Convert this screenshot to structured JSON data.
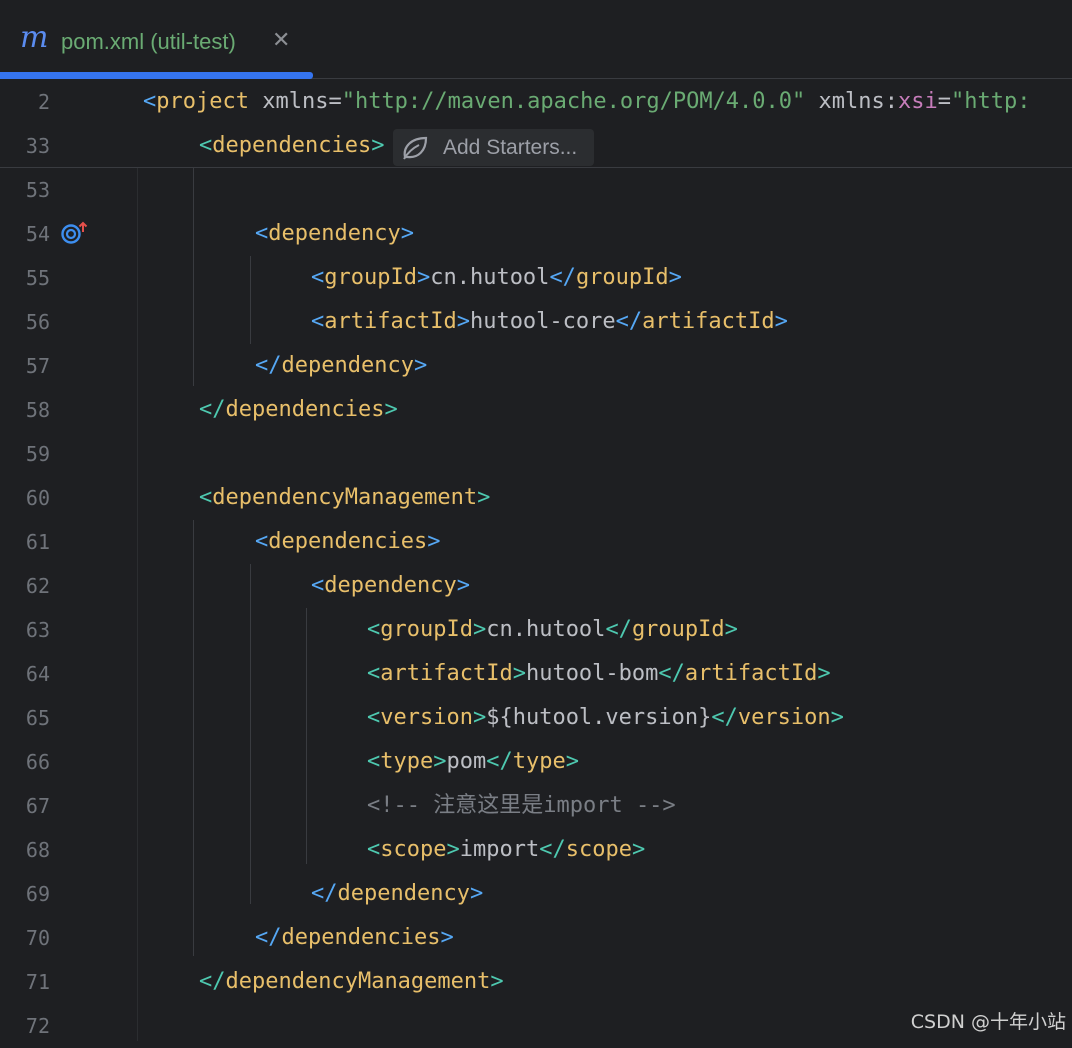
{
  "tab": {
    "icon": "m",
    "label": "pom.xml (util-test)",
    "close": "✕"
  },
  "hint": {
    "label": "Add Starters..."
  },
  "watermark": "CSDN @十年小站",
  "lines": [
    {
      "n": "2",
      "parts": [
        [
          "b",
          "<"
        ],
        [
          "t",
          "project"
        ],
        [
          "at",
          " xmlns"
        ],
        [
          "tx",
          "="
        ],
        [
          "str",
          "\"http://maven.apache.org/POM/4.0.0\""
        ],
        [
          "at",
          " xmlns"
        ],
        [
          "tx",
          ":"
        ],
        [
          "ns",
          "xsi"
        ],
        [
          "tx",
          "="
        ],
        [
          "str",
          "\"http:"
        ]
      ]
    },
    {
      "n": "33",
      "parts": [
        [
          "g",
          "<"
        ],
        [
          "t",
          "dependencies"
        ],
        [
          "g",
          ">"
        ]
      ]
    },
    {
      "n": "53",
      "parts": []
    },
    {
      "n": "54",
      "parts": [
        [
          "b",
          "<"
        ],
        [
          "t",
          "dependency"
        ],
        [
          "b",
          ">"
        ]
      ]
    },
    {
      "n": "55",
      "parts": [
        [
          "b",
          "<"
        ],
        [
          "t",
          "groupId"
        ],
        [
          "b",
          ">"
        ],
        [
          "tx",
          "cn.hutool"
        ],
        [
          "b",
          "</"
        ],
        [
          "t",
          "groupId"
        ],
        [
          "b",
          ">"
        ]
      ]
    },
    {
      "n": "56",
      "parts": [
        [
          "b",
          "<"
        ],
        [
          "t",
          "artifactId"
        ],
        [
          "b",
          ">"
        ],
        [
          "tx",
          "hutool-core"
        ],
        [
          "b",
          "</"
        ],
        [
          "t",
          "artifactId"
        ],
        [
          "b",
          ">"
        ]
      ]
    },
    {
      "n": "57",
      "parts": [
        [
          "b",
          "</"
        ],
        [
          "t",
          "dependency"
        ],
        [
          "b",
          ">"
        ]
      ]
    },
    {
      "n": "58",
      "parts": [
        [
          "g",
          "</"
        ],
        [
          "t",
          "dependencies"
        ],
        [
          "g",
          ">"
        ]
      ]
    },
    {
      "n": "59",
      "parts": []
    },
    {
      "n": "60",
      "parts": [
        [
          "g",
          "<"
        ],
        [
          "t",
          "dependencyManagement"
        ],
        [
          "g",
          ">"
        ]
      ]
    },
    {
      "n": "61",
      "parts": [
        [
          "b",
          "<"
        ],
        [
          "t",
          "dependencies"
        ],
        [
          "b",
          ">"
        ]
      ]
    },
    {
      "n": "62",
      "parts": [
        [
          "b",
          "<"
        ],
        [
          "t",
          "dependency"
        ],
        [
          "b",
          ">"
        ]
      ]
    },
    {
      "n": "63",
      "parts": [
        [
          "g",
          "<"
        ],
        [
          "t",
          "groupId"
        ],
        [
          "g",
          ">"
        ],
        [
          "tx",
          "cn.hutool"
        ],
        [
          "g",
          "</"
        ],
        [
          "t",
          "groupId"
        ],
        [
          "g",
          ">"
        ]
      ]
    },
    {
      "n": "64",
      "parts": [
        [
          "g",
          "<"
        ],
        [
          "t",
          "artifactId"
        ],
        [
          "g",
          ">"
        ],
        [
          "tx",
          "hutool-bom"
        ],
        [
          "g",
          "</"
        ],
        [
          "t",
          "artifactId"
        ],
        [
          "g",
          ">"
        ]
      ]
    },
    {
      "n": "65",
      "parts": [
        [
          "g",
          "<"
        ],
        [
          "t",
          "version"
        ],
        [
          "g",
          ">"
        ],
        [
          "tx",
          "${hutool.version}"
        ],
        [
          "g",
          "</"
        ],
        [
          "t",
          "version"
        ],
        [
          "g",
          ">"
        ]
      ]
    },
    {
      "n": "66",
      "parts": [
        [
          "g",
          "<"
        ],
        [
          "t",
          "type"
        ],
        [
          "g",
          ">"
        ],
        [
          "tx",
          "pom"
        ],
        [
          "g",
          "</"
        ],
        [
          "t",
          "type"
        ],
        [
          "g",
          ">"
        ]
      ]
    },
    {
      "n": "67",
      "parts": [
        [
          "cm",
          "<!-- 注意这里是import -->"
        ]
      ]
    },
    {
      "n": "68",
      "parts": [
        [
          "g",
          "<"
        ],
        [
          "t",
          "scope"
        ],
        [
          "g",
          ">"
        ],
        [
          "tx",
          "import"
        ],
        [
          "g",
          "</"
        ],
        [
          "t",
          "scope"
        ],
        [
          "g",
          ">"
        ]
      ]
    },
    {
      "n": "69",
      "parts": [
        [
          "b",
          "</"
        ],
        [
          "t",
          "dependency"
        ],
        [
          "b",
          ">"
        ]
      ]
    },
    {
      "n": "70",
      "parts": [
        [
          "b",
          "</"
        ],
        [
          "t",
          "dependencies"
        ],
        [
          "b",
          ">"
        ]
      ]
    },
    {
      "n": "71",
      "parts": [
        [
          "g",
          "</"
        ],
        [
          "t",
          "dependencyManagement"
        ],
        [
          "g",
          ">"
        ]
      ]
    },
    {
      "n": "72",
      "parts": []
    }
  ]
}
